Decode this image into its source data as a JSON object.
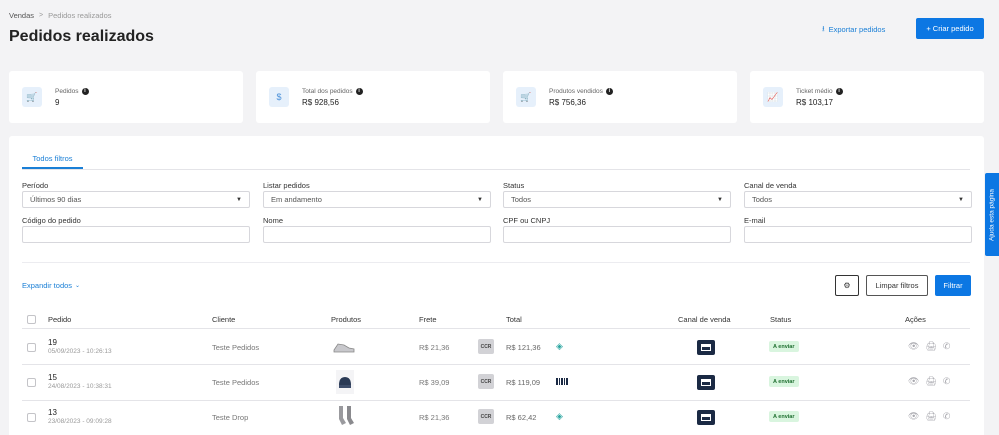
{
  "breadcrumb": {
    "root": "Vendas",
    "separator": ">",
    "current": "Pedidos realizados"
  },
  "page_title": "Pedidos realizados",
  "header": {
    "export_label": "Exportar pedidos",
    "create_label": "+ Criar pedido"
  },
  "stats": [
    {
      "label": "Pedidos",
      "value": "9",
      "icon": "cart-icon"
    },
    {
      "label": "Total dos pedidos",
      "value": "R$ 928,56",
      "icon": "dollar-icon"
    },
    {
      "label": "Produtos vendidos",
      "value": "R$ 756,36",
      "icon": "cart-icon"
    },
    {
      "label": "Ticket médio",
      "value": "R$ 103,17",
      "icon": "chart-icon"
    }
  ],
  "tabs": {
    "all_filters": "Todos filtros"
  },
  "filters": {
    "periodo": {
      "label": "Período",
      "value": "Últimos 90 dias"
    },
    "listar": {
      "label": "Listar pedidos",
      "value": "Em andamento"
    },
    "status": {
      "label": "Status",
      "value": "Todos"
    },
    "canal": {
      "label": "Canal de venda",
      "value": "Todos"
    },
    "codigo": {
      "label": "Código do pedido",
      "value": ""
    },
    "nome": {
      "label": "Nome",
      "value": ""
    },
    "cpf": {
      "label": "CPF ou CNPJ",
      "value": ""
    },
    "email": {
      "label": "E-mail",
      "value": ""
    }
  },
  "actions": {
    "expand_all": "Expandir todos",
    "clear_filters": "Limpar filtros",
    "filter": "Filtrar"
  },
  "table": {
    "columns": {
      "pedido": "Pedido",
      "cliente": "Cliente",
      "produtos": "Produtos",
      "frete": "Frete",
      "total": "Total",
      "canal": "Canal de venda",
      "status": "Status",
      "acoes": "Ações"
    },
    "rows": [
      {
        "number": "19",
        "date": "05/09/2023 - 10:26:13",
        "cliente": "Teste Pedidos",
        "frete": "R$ 21,36",
        "carrier": "CCR",
        "total": "R$ 121,36",
        "status": "A enviar"
      },
      {
        "number": "15",
        "date": "24/08/2023 - 10:38:31",
        "cliente": "Teste Pedidos",
        "frete": "R$ 39,09",
        "carrier": "CCR",
        "total": "R$ 119,09",
        "status": "A enviar"
      },
      {
        "number": "13",
        "date": "23/08/2023 - 09:09:28",
        "cliente": "Teste Drop",
        "frete": "R$ 21,36",
        "carrier": "CCR",
        "total": "R$ 62,42",
        "status": "A enviar"
      }
    ]
  },
  "side_tab": "Ajuda esta página",
  "colors": {
    "primary": "#0c77e3",
    "status_bg": "#d9f5df",
    "status_text": "#1e6e2f",
    "store_icon": "#1b2a44"
  }
}
